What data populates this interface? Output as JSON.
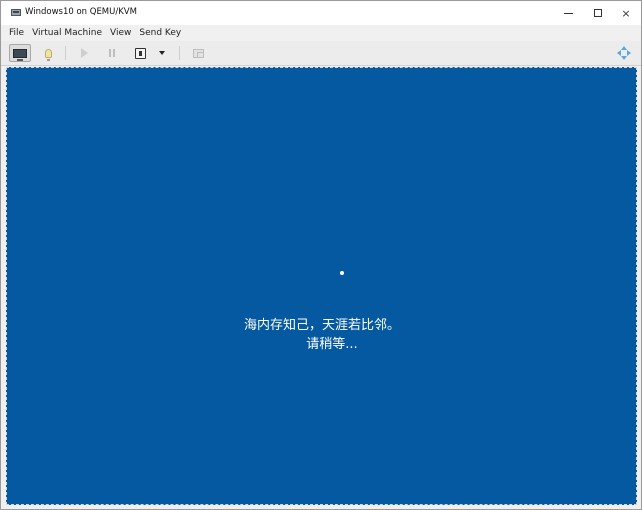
{
  "window": {
    "title": "Windows10 on QEMU/KVM",
    "icon": "vm-monitor-icon",
    "controls": {
      "minimize": "minimize-icon",
      "maximize": "maximize-icon",
      "close": "×"
    }
  },
  "menu": {
    "items": [
      "File",
      "Virtual Machine",
      "View",
      "Send Key"
    ]
  },
  "toolbar": {
    "buttons": [
      {
        "name": "console-view-button",
        "icon": "monitor-icon",
        "active": true
      },
      {
        "name": "details-view-button",
        "icon": "lightbulb-icon"
      },
      {
        "name": "run-button",
        "icon": "play-icon",
        "disabled": true
      },
      {
        "name": "pause-button",
        "icon": "pause-icon",
        "disabled": true
      },
      {
        "name": "shutdown-button",
        "icon": "power-icon"
      },
      {
        "name": "shutdown-menu-button",
        "icon": "chevron-down-icon"
      },
      {
        "name": "snapshots-button",
        "icon": "snapshot-icon",
        "disabled": true
      },
      {
        "name": "fullscreen-move-button",
        "icon": "move-icon"
      }
    ]
  },
  "guest": {
    "background": "#0559a0",
    "line1": "海内存知己，天涯若比邻。",
    "line2": "请稍等..."
  }
}
